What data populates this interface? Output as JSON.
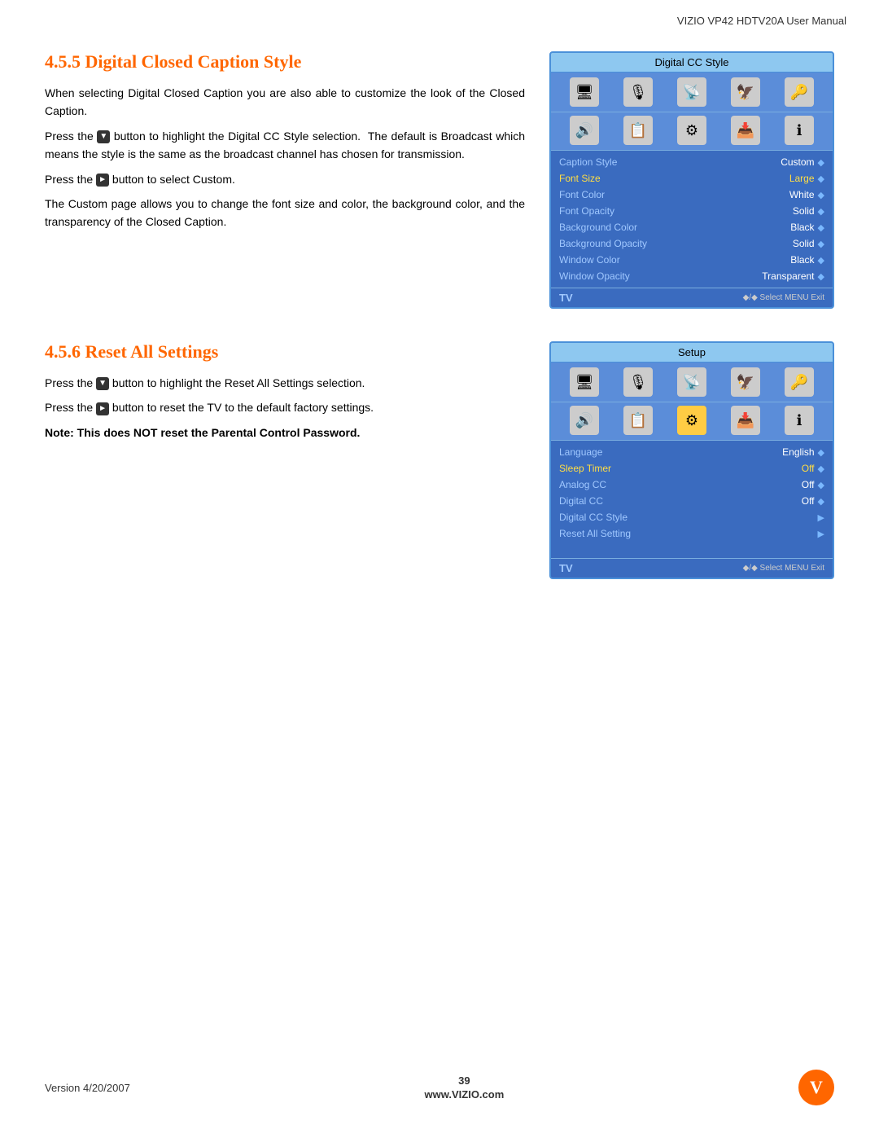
{
  "header": {
    "title": "VIZIO VP42 HDTV20A User Manual"
  },
  "section455": {
    "title": "4.5.5 Digital Closed Caption Style",
    "paragraphs": [
      "When selecting Digital Closed Caption you are also able to customize the look of the Closed Caption.",
      "Press the  button to highlight the Digital CC Style selection.  The default is Broadcast which means the style is the same as the broadcast channel has chosen for transmission.",
      "Press the  button to select Custom.",
      "The Custom page allows you to change the font size and color, the background color, and the transparency of the Closed Caption."
    ],
    "screen": {
      "title": "Digital CC Style",
      "menu_items": [
        {
          "label": "Caption Style",
          "value": "Custom",
          "arrow": "◆",
          "highlight": false
        },
        {
          "label": "Font Size",
          "value": "Large",
          "arrow": "◆",
          "highlight": true
        },
        {
          "label": "Font Color",
          "value": "White",
          "arrow": "◆",
          "highlight": false
        },
        {
          "label": "Font Opacity",
          "value": "Solid",
          "arrow": "◆",
          "highlight": false
        },
        {
          "label": "Background Color",
          "value": "Black",
          "arrow": "◆",
          "highlight": false
        },
        {
          "label": "Background Opacity",
          "value": "Solid",
          "arrow": "◆",
          "highlight": false
        },
        {
          "label": "Window Color",
          "value": "Black",
          "arrow": "◆",
          "highlight": false
        },
        {
          "label": "Window Opacity",
          "value": "Transparent",
          "arrow": "◆",
          "highlight": false
        }
      ],
      "footer_label": "TV",
      "footer_hint": "◆/◆ Select MENU Exit"
    }
  },
  "section456": {
    "title": "4.5.6 Reset All Settings",
    "paragraphs": [
      "Press the  button to highlight the Reset All Settings selection.",
      "Press the  button to reset the TV to the default factory settings."
    ],
    "bold_note": "Note: This does NOT reset the Parental Control Password.",
    "screen": {
      "title": "Setup",
      "menu_items": [
        {
          "label": "Language",
          "value": "English",
          "arrow": "◆",
          "highlight": false
        },
        {
          "label": "Sleep Timer",
          "value": "Off",
          "arrow": "◆",
          "highlight": true
        },
        {
          "label": "Analog CC",
          "value": "Off",
          "arrow": "◆",
          "highlight": false
        },
        {
          "label": "Digital CC",
          "value": "Off",
          "arrow": "◆",
          "highlight": false
        },
        {
          "label": "Digital CC Style",
          "value": "",
          "arrow": "▶",
          "highlight": false
        },
        {
          "label": "Reset All Setting",
          "value": "",
          "arrow": "▶",
          "highlight": false
        }
      ],
      "footer_label": "TV",
      "footer_hint": "◆/◆ Select MENU Exit"
    }
  },
  "footer": {
    "version": "Version 4/20/2007",
    "page_number": "39",
    "website": "www.VIZIO.com",
    "logo_text": "V"
  }
}
